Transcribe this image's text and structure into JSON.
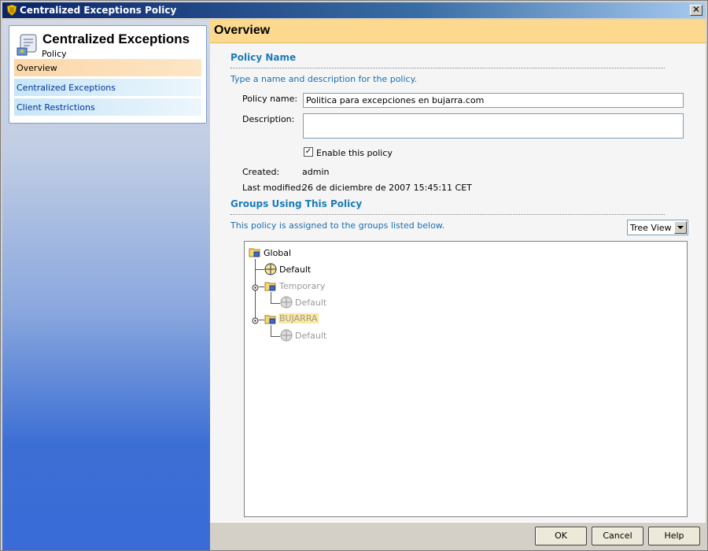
{
  "window": {
    "title": "Centralized Exceptions Policy",
    "close_glyph": "✕",
    "icon": "shield-icon"
  },
  "sidebar": {
    "title": "Centralized Exceptions",
    "subtitle": "Policy",
    "icon": "scroll-policy-icon",
    "items": [
      {
        "label": "Overview",
        "selected": true
      },
      {
        "label": "Centralized Exceptions",
        "selected": false
      },
      {
        "label": "Client Restrictions",
        "selected": false
      }
    ]
  },
  "main": {
    "header": "Overview",
    "policy_name_section": {
      "title": "Policy Name",
      "help": "Type a name and description for the policy.",
      "policy_name_label": "Policy name:",
      "policy_name_value": "Politica para excepciones en bujarra.com",
      "description_label": "Description:",
      "description_value": "",
      "enable_label": "Enable this policy",
      "enable_checked": true,
      "created_label": "Created:",
      "created_value": "admin",
      "last_modified_label": "Last modified:",
      "last_modified_value": "26 de diciembre de 2007 15:45:11 CET"
    },
    "groups_section": {
      "title": "Groups Using This Policy",
      "help": "This policy is assigned to the groups listed below.",
      "view_select": "Tree View",
      "tree": [
        {
          "label": "Global",
          "type": "folder",
          "muted": false
        },
        {
          "label": "Default",
          "type": "group",
          "muted": false
        },
        {
          "label": "Temporary",
          "type": "folder",
          "muted": true
        },
        {
          "label": "Default",
          "type": "group",
          "muted": true
        },
        {
          "label": "BUJARRA",
          "type": "folder",
          "muted": true,
          "highlight": true
        },
        {
          "label": "Default",
          "type": "group",
          "muted": true
        }
      ]
    }
  },
  "buttons": {
    "ok": "OK",
    "cancel": "Cancel",
    "help": "Help"
  },
  "colors": {
    "accent_header": "#fcd98f",
    "section_title": "#1a7cb8",
    "nav_selected": "#fbd7a8"
  }
}
